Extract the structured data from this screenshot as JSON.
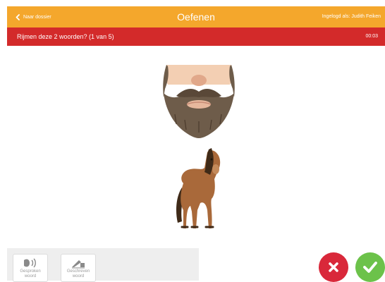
{
  "header": {
    "back_label": "Naar dossier",
    "title": "Oefenen",
    "user_label": "Ingelogd als: Judith Feiken",
    "accent_color": "#f4a72c"
  },
  "question_bar": {
    "question": "Rijmen deze 2 woorden?  (1 van 5)",
    "timer": "00:03",
    "color": "#d32a2a"
  },
  "pictures": [
    {
      "icon": "beard-icon"
    },
    {
      "icon": "horse-icon"
    }
  ],
  "tools": [
    {
      "label_line1": "Gesproken",
      "label_line2": "woord",
      "icon": "speaker-icon"
    },
    {
      "label_line1": "Geschreven",
      "label_line2": "woord",
      "icon": "pen-icon"
    }
  ],
  "answers": {
    "no": {
      "icon": "cross-icon",
      "color": "#d9283a"
    },
    "yes": {
      "icon": "check-icon",
      "color": "#6cc24a"
    }
  }
}
